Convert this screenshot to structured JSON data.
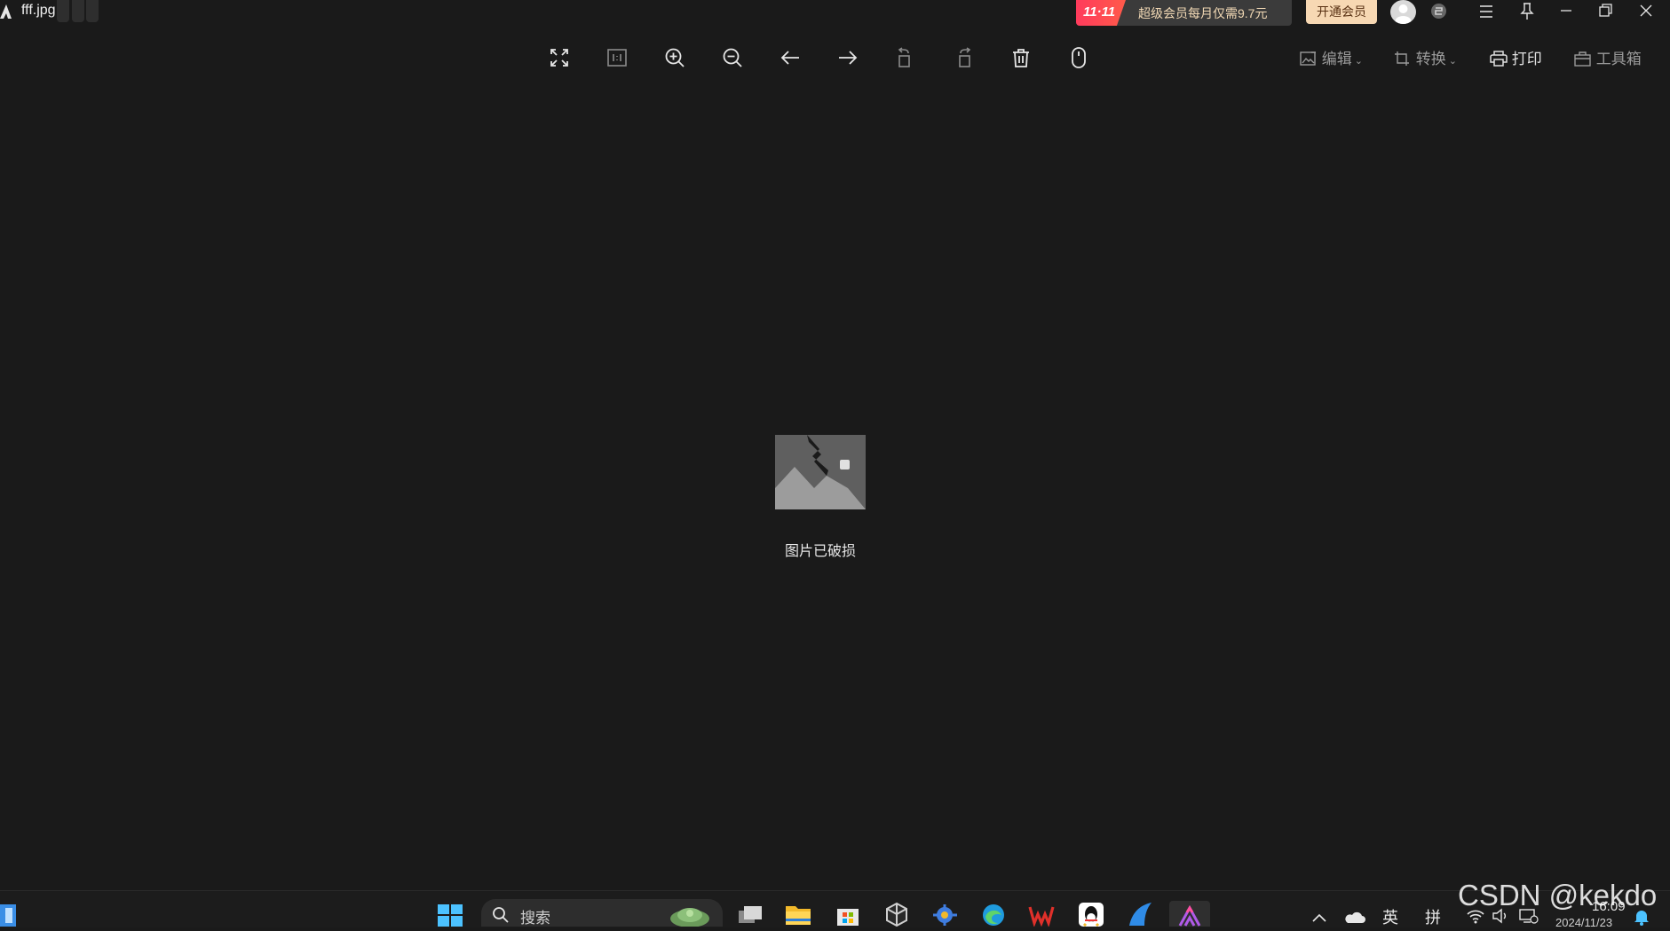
{
  "titlebar": {
    "file_name": "fff.jpg",
    "promo_badge": "11·11",
    "promo_text": "超级会员每月仅需9.7元",
    "member_button": "开通会员"
  },
  "toolbar": {
    "icons": [
      "fullscreen-icon",
      "actual-size-icon",
      "zoom-in-icon",
      "zoom-out-icon",
      "previous-icon",
      "next-icon",
      "rotate-left-icon",
      "rotate-right-icon",
      "delete-icon",
      "mouse-icon"
    ],
    "edit_label": "编辑",
    "convert_label": "转换",
    "print_label": "打印",
    "toolbox_label": "工具箱"
  },
  "viewer": {
    "status_text": "图片已破损"
  },
  "taskbar": {
    "search_placeholder": "搜索",
    "lang_label": "英",
    "ime_label": "拼",
    "clock": "16:09",
    "date": "2024/11/23"
  },
  "watermark": "CSDN @kekdo",
  "colors": {
    "background": "#1a1a1a",
    "promo_badge": "#ff3b5c",
    "member_button": "#f7d8b3"
  }
}
